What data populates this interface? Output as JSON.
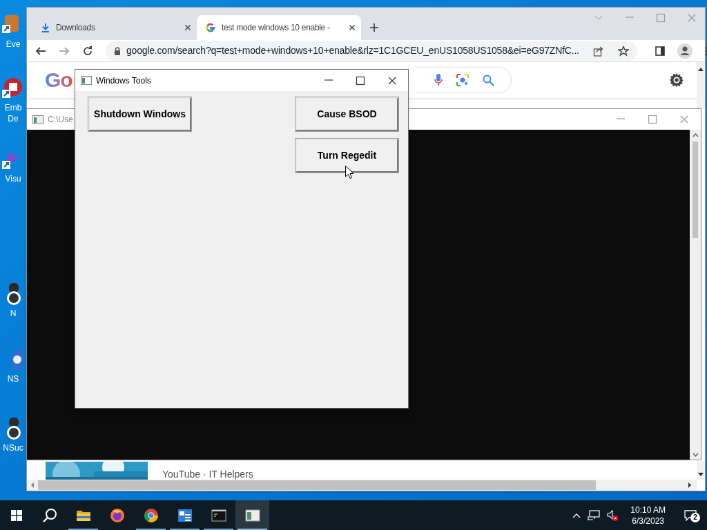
{
  "desktop_icons": [
    {
      "label": "Eve"
    },
    {
      "label": "Emb De"
    },
    {
      "label": "Visu"
    },
    {
      "label": "N"
    },
    {
      "label": "NS"
    },
    {
      "label": "NSuc"
    }
  ],
  "browser": {
    "tabs": [
      {
        "title": "Downloads",
        "kind": "downloads",
        "selected": false
      },
      {
        "title": "test mode windows 10 enable -",
        "kind": "google",
        "selected": true
      }
    ],
    "address": "google.com/search?q=test+mode+windows+10+enable&rlz=1C1GCEU_enUS1058US1058&ei=eG97ZNfC...",
    "logo": "Go",
    "result": {
      "source": "YouTube · IT Helpers"
    }
  },
  "console": {
    "title": "C:\\Use"
  },
  "tool_window": {
    "title": "Windows Tools",
    "buttons": [
      {
        "label": "Shutdown Windows"
      },
      {
        "label": "Cause BSOD"
      },
      {
        "label": "Turn Regedit"
      }
    ]
  },
  "taskbar": {
    "apps": [
      {
        "kind": "explorer",
        "running": true,
        "selected": false
      },
      {
        "kind": "firefox",
        "running": false,
        "selected": false
      },
      {
        "kind": "chrome",
        "running": true,
        "selected": false
      },
      {
        "kind": "tool",
        "running": true,
        "selected": false
      },
      {
        "kind": "console",
        "running": true,
        "selected": false
      },
      {
        "kind": "window",
        "running": true,
        "selected": true
      }
    ],
    "time": "10:10 AM",
    "date": "6/3/2023",
    "notifications": "2"
  }
}
